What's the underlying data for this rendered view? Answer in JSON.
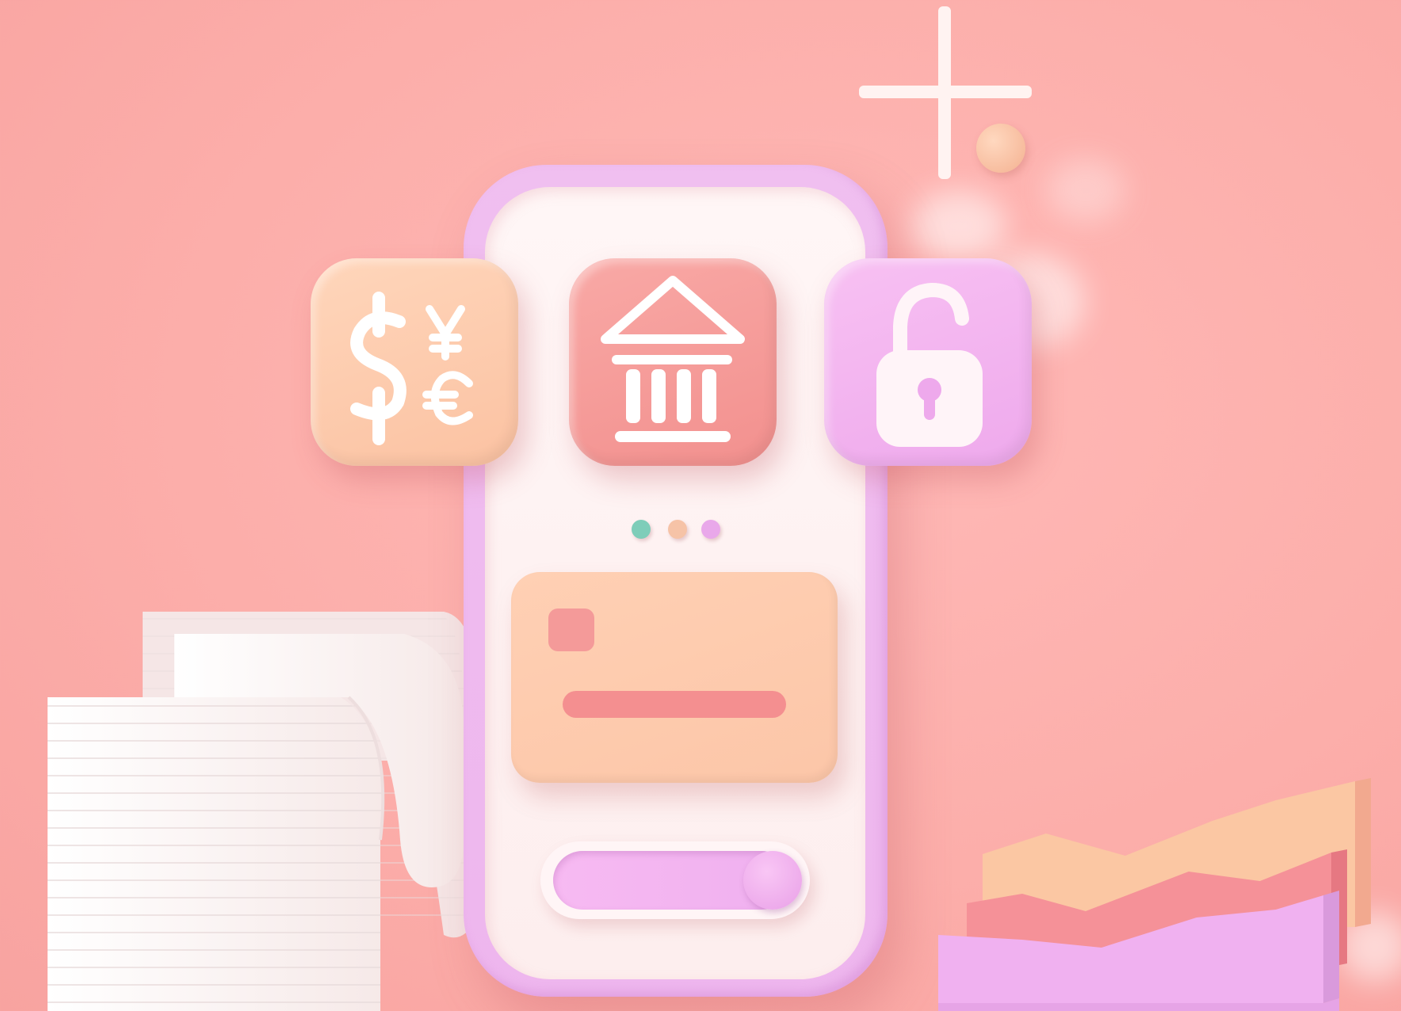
{
  "scene": {
    "description_icons": [
      "currency-exchange-icon",
      "bank-icon",
      "lock-icon"
    ],
    "pagination_dots": [
      "#7ecdb9",
      "#f6c3a7",
      "#e9a8ea"
    ],
    "colors": {
      "background": "#fcaeaa",
      "phone_frame": "#efbbef",
      "screen": "#fff4f4",
      "currency_tile": "#fcc7a8",
      "bank_tile": "#f59a97",
      "lock_tile": "#f2b2ee",
      "card": "#fdcaad",
      "card_stripe": "#f48f90",
      "toggle_fill": "#f2b2ef"
    },
    "toggle": {
      "state": "on"
    }
  }
}
